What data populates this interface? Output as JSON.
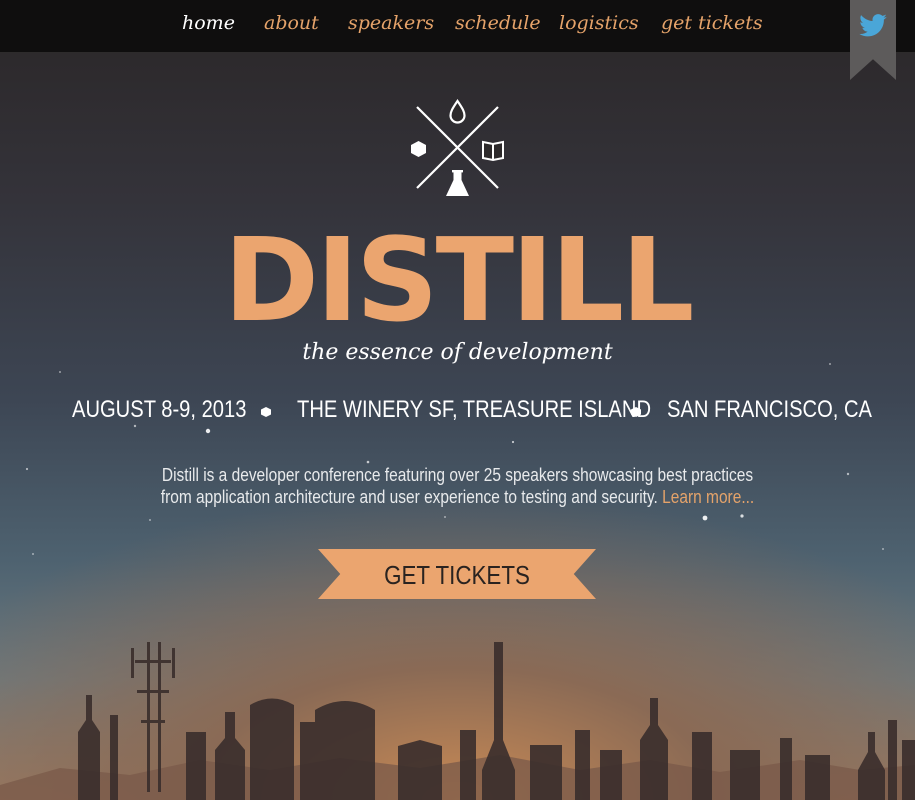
{
  "nav": {
    "items": [
      "home",
      "about",
      "speakers",
      "schedule",
      "logistics",
      "get tickets"
    ],
    "active": "home"
  },
  "social": {
    "icon": "twitter-icon"
  },
  "hero": {
    "logo_icons": [
      "drop-icon",
      "hexagon-icon",
      "book-icon",
      "flask-icon"
    ],
    "title": "DISTILL",
    "tagline": "the essence of development",
    "date": "AUGUST 8-9, 2013",
    "venue": "THE WINERY SF, TREASURE ISLAND",
    "city": "SAN FRANCISCO, CA",
    "description": "Distill is a developer conference featuring over 25 speakers showcasing best practices from application architecture and user experience to testing and security.",
    "learn_more": "Learn more...",
    "cta": "GET TICKETS"
  },
  "colors": {
    "accent": "#eba56f",
    "nav_link": "#e5a36a",
    "nav_bg": "#0f0e0e",
    "twitter": "#4aa6d8",
    "ribbon": "#5d5b5b"
  }
}
